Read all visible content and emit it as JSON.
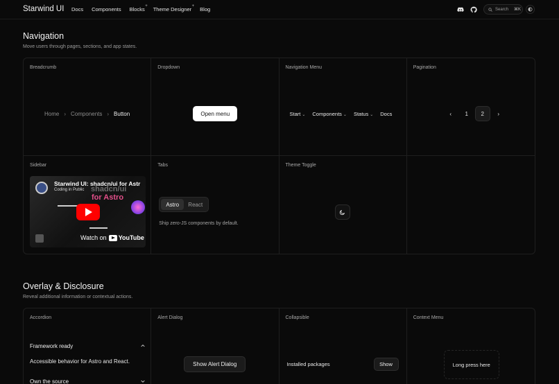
{
  "header": {
    "brand": "Starwind UI",
    "nav": [
      {
        "label": "Docs",
        "badge": ""
      },
      {
        "label": "Components",
        "badge": ""
      },
      {
        "label": "Blocks",
        "badge": "+"
      },
      {
        "label": "Theme Designer",
        "badge": "+"
      },
      {
        "label": "Blog",
        "badge": ""
      }
    ],
    "icons": [
      "discord-icon",
      "github-icon"
    ],
    "search_label": "Search",
    "search_shortcut": "⌘K"
  },
  "sections": {
    "navigation": {
      "title": "Navigation",
      "description": "Move users through pages, sections, and app states.",
      "cards": {
        "breadcrumb": {
          "label": "Breadcrumb",
          "items": [
            "Home",
            "Components",
            "Button"
          ]
        },
        "dropdown": {
          "label": "Dropdown",
          "button": "Open menu"
        },
        "navigation_menu": {
          "label": "Navigation Menu",
          "items": [
            "Start",
            "Components",
            "Status",
            "Docs"
          ]
        },
        "pagination": {
          "label": "Pagination",
          "pages": [
            "1",
            "2"
          ],
          "current": "2"
        },
        "sidebar": {
          "label": "Sidebar",
          "video_title": "Starwind UI: shadcn/ui for Astr",
          "video_channel": "Coding in Public",
          "video_overlay_1": "shadcn/ui",
          "video_overlay_2": "for Astro",
          "watch_on": "Watch on",
          "youtube": "YouTube"
        },
        "tabs": {
          "label": "Tabs",
          "tabs": [
            "Astro",
            "React"
          ],
          "active": "Astro",
          "content": "Ship zero-JS components by default."
        },
        "theme_toggle": {
          "label": "Theme Toggle"
        }
      }
    },
    "overlay": {
      "title": "Overlay & Disclosure",
      "description": "Reveal additional information or contextual actions.",
      "cards": {
        "accordion": {
          "label": "Accordion",
          "items": [
            {
              "title": "Framework ready",
              "content": "Accessible behavior for Astro and React.",
              "open": true
            },
            {
              "title": "Own the source",
              "open": false
            }
          ]
        },
        "alert_dialog": {
          "label": "Alert Dialog",
          "button": "Show Alert Dialog"
        },
        "collapsible": {
          "label": "Collapsible",
          "text": "Installed packages",
          "button": "Show"
        },
        "context_menu": {
          "label": "Context Menu",
          "area_text": "Long press here"
        }
      }
    }
  }
}
